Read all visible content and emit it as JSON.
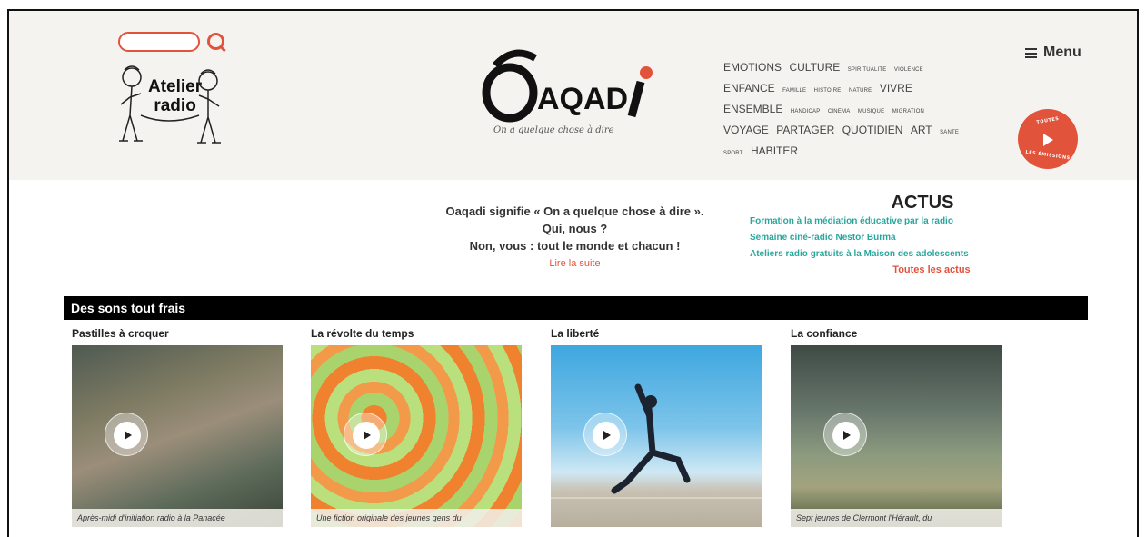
{
  "search": {
    "placeholder": ""
  },
  "atelier": {
    "line1": "Atelier",
    "line2": "radio"
  },
  "brand": {
    "name": "OAQADI",
    "tagline": "On a quelque chose à dire",
    "accent": "#e2533c"
  },
  "tags": [
    {
      "label": "EMOTIONS",
      "size": "lg"
    },
    {
      "label": "CULTURE",
      "size": "lg"
    },
    {
      "label": "SPIRITUALITE",
      "size": "sm"
    },
    {
      "label": "VIOLENCE",
      "size": "sm"
    },
    {
      "label": "ENFANCE",
      "size": "lg"
    },
    {
      "label": "FAMILLE",
      "size": "sm"
    },
    {
      "label": "HISTOIRE",
      "size": "sm"
    },
    {
      "label": "NATURE",
      "size": "sm"
    },
    {
      "label": "VIVRE",
      "size": "lg"
    },
    {
      "label": "ENSEMBLE",
      "size": "lg"
    },
    {
      "label": "HANDICAP",
      "size": "sm"
    },
    {
      "label": "CINEMA",
      "size": "sm"
    },
    {
      "label": "MUSIQUE",
      "size": "sm"
    },
    {
      "label": "MIGRATION",
      "size": "sm"
    },
    {
      "label": "VOYAGE",
      "size": "lg"
    },
    {
      "label": "PARTAGER",
      "size": "lg"
    },
    {
      "label": "QUOTIDIEN",
      "size": "lg"
    },
    {
      "label": "ART",
      "size": "lg"
    },
    {
      "label": "SANTE",
      "size": "sm"
    },
    {
      "label": "SPORT",
      "size": "sm"
    },
    {
      "label": "HABITER",
      "size": "lg"
    }
  ],
  "menu": {
    "label": "Menu"
  },
  "badge": {
    "top": "TOUTES",
    "bottom": "LES ÉMISSIONS"
  },
  "intro": {
    "line1": "Oaqadi signifie « On a quelque chose à dire ».",
    "line2": "Qui, nous ?",
    "line3": "Non, vous : tout le monde et chacun !",
    "read_more": "Lire la suite"
  },
  "actus": {
    "title": "ACTUS",
    "items": [
      "Formation à la médiation éducative par la radio",
      "Semaine ciné-radio Nestor Burma",
      "Ateliers radio gratuits à la Maison des adolescents"
    ],
    "all_label": "Toutes les actus"
  },
  "section": {
    "title": "Des sons tout frais"
  },
  "cards": [
    {
      "title": "Pastilles à croquer",
      "caption": "Après-midi d'initiation radio à la Panacée",
      "image": "otter"
    },
    {
      "title": "La révolte du temps",
      "caption": "Une fiction originale des jeunes gens du",
      "image": "pills"
    },
    {
      "title": "La liberté",
      "caption": "",
      "image": "sky"
    },
    {
      "title": "La confiance",
      "caption": "Sept jeunes de Clermont l'Hérault, du",
      "image": "hills"
    }
  ]
}
